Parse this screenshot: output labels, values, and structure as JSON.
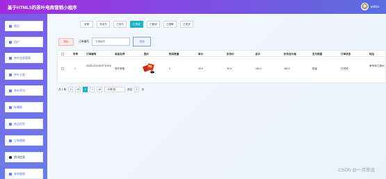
{
  "app": {
    "title": "基于HTML5的茶叶电商营销小程序",
    "user": "admin"
  },
  "sidebar": {
    "items": [
      {
        "label": "首页"
      },
      {
        "label": "用户"
      },
      {
        "label": "茶叶信息管理"
      },
      {
        "label": "茶叶分类"
      },
      {
        "label": "茶叶资讯"
      },
      {
        "label": "轮播图"
      },
      {
        "label": "商品信息"
      },
      {
        "label": "订单管理"
      },
      {
        "label": "资讯信息"
      },
      {
        "label": "系统管理"
      }
    ]
  },
  "tabs": [
    "全部",
    "未支付",
    "已支付",
    "已完成",
    "已取消",
    "已退款",
    "已发货"
  ],
  "toolbar": {
    "delete_label": "删除",
    "search_label": "订单编号",
    "search_placeholder": "订单编号",
    "search_button": "查询"
  },
  "table": {
    "headers": [
      "序号",
      "订单编号",
      "商品名称",
      "图片",
      "购买数量",
      "单价",
      "折扣价",
      "总价",
      "折扣总价格",
      "支付类型",
      "订单状态",
      "地址"
    ],
    "rows": [
      {
        "index": "1",
        "order_no": "202512121523711915",
        "name": "茶叶秀般",
        "qty": "2",
        "price": "90.0",
        "discount_price": "90.0",
        "total": "180.0",
        "discount_total": "180.0",
        "pay_type": "现金",
        "status": "已完成",
        "address": "单号浙江湖州"
      }
    ]
  },
  "pager": {
    "total": "共 1 条",
    "prev": "2",
    "prev2": "10",
    "current": "1",
    "next": ">",
    "next2": "10",
    "page_size": "10条/页",
    "goto_label": "前往",
    "goto_value": "1",
    "page_unit": "页"
  },
  "watermark": "CSDN @一点毕设",
  "colors": {
    "accent": "#1fb3c5",
    "header_start": "#a52adf",
    "header_end": "#5a6ee0"
  }
}
